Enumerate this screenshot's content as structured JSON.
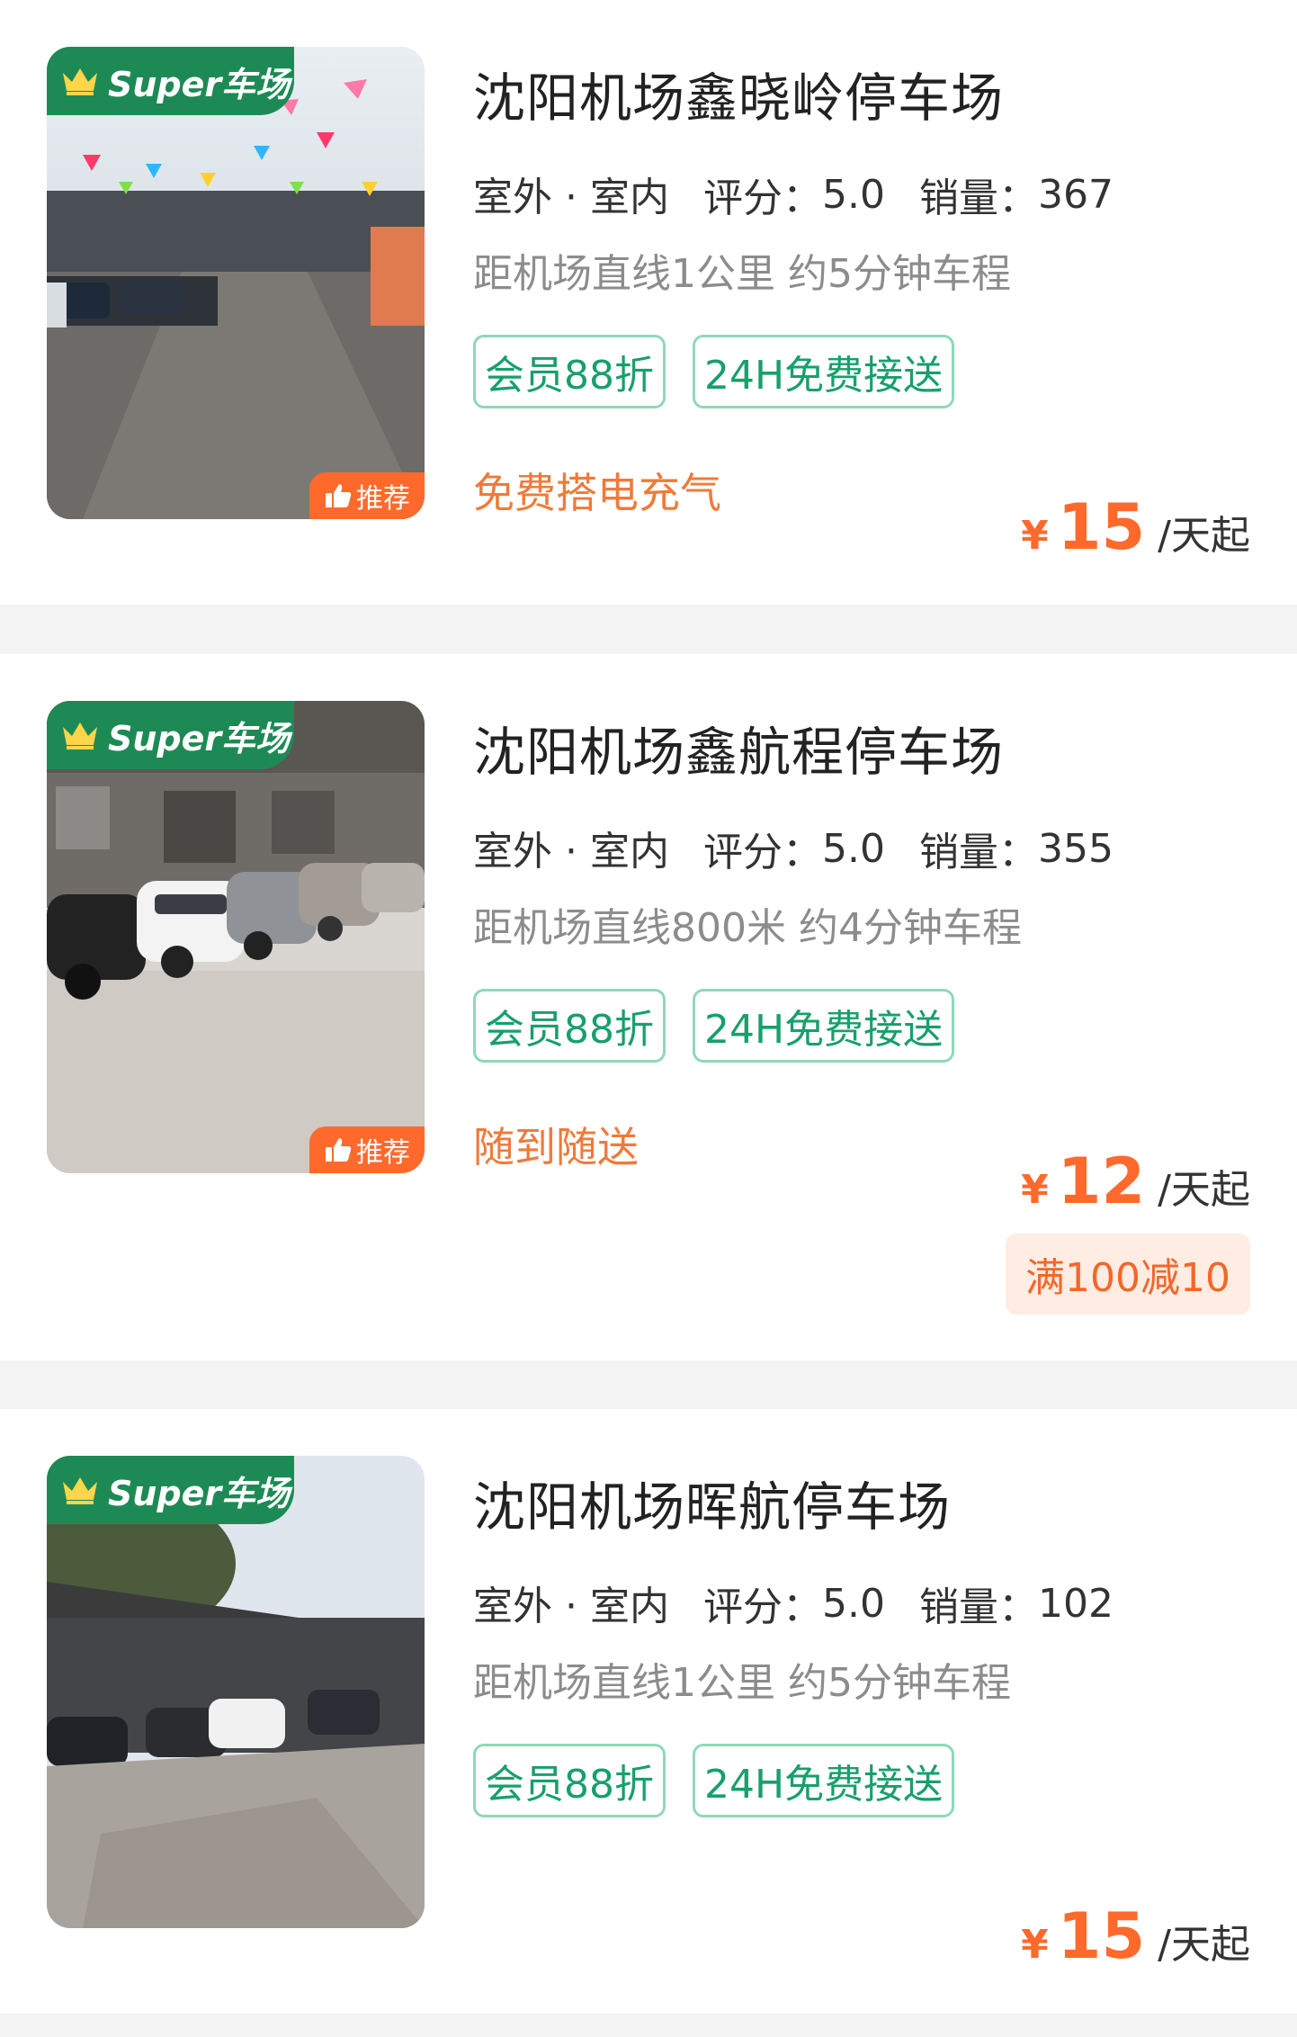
{
  "cards": [
    {
      "badge": "Super车场",
      "recommend": "推荐",
      "title": "沈阳机场鑫晓岭停车场",
      "location_type": "室外 · 室内",
      "rating_label": "评分：",
      "rating": "5.0",
      "sales_label": "销量：",
      "sales": "367",
      "distance": "距机场直线1公里 约5分钟车程",
      "tags": [
        "会员88折",
        "24H免费接送"
      ],
      "service": "免费搭电充气",
      "price_symbol": "¥",
      "price": "15",
      "price_unit": "/天起"
    },
    {
      "badge": "Super车场",
      "recommend": "推荐",
      "title": "沈阳机场鑫航程停车场",
      "location_type": "室外 · 室内",
      "rating_label": "评分：",
      "rating": "5.0",
      "sales_label": "销量：",
      "sales": "355",
      "distance": "距机场直线800米 约4分钟车程",
      "tags": [
        "会员88折",
        "24H免费接送"
      ],
      "service": "随到随送",
      "price_symbol": "¥",
      "price": "12",
      "price_unit": "/天起",
      "promo": "满100减10"
    },
    {
      "badge": "Super车场",
      "title": "沈阳机场晖航停车场",
      "location_type": "室外 · 室内",
      "rating_label": "评分：",
      "rating": "5.0",
      "sales_label": "销量：",
      "sales": "102",
      "distance": "距机场直线1公里 约5分钟车程",
      "tags": [
        "会员88折",
        "24H免费接送"
      ],
      "price_symbol": "¥",
      "price": "15",
      "price_unit": "/天起"
    }
  ],
  "colors": {
    "accent_green": "#1d8a55",
    "tag_green": "#17a06a",
    "price_orange": "#ff6a2c",
    "service_orange": "#f07a3a",
    "promo_bg": "#ffece3"
  }
}
